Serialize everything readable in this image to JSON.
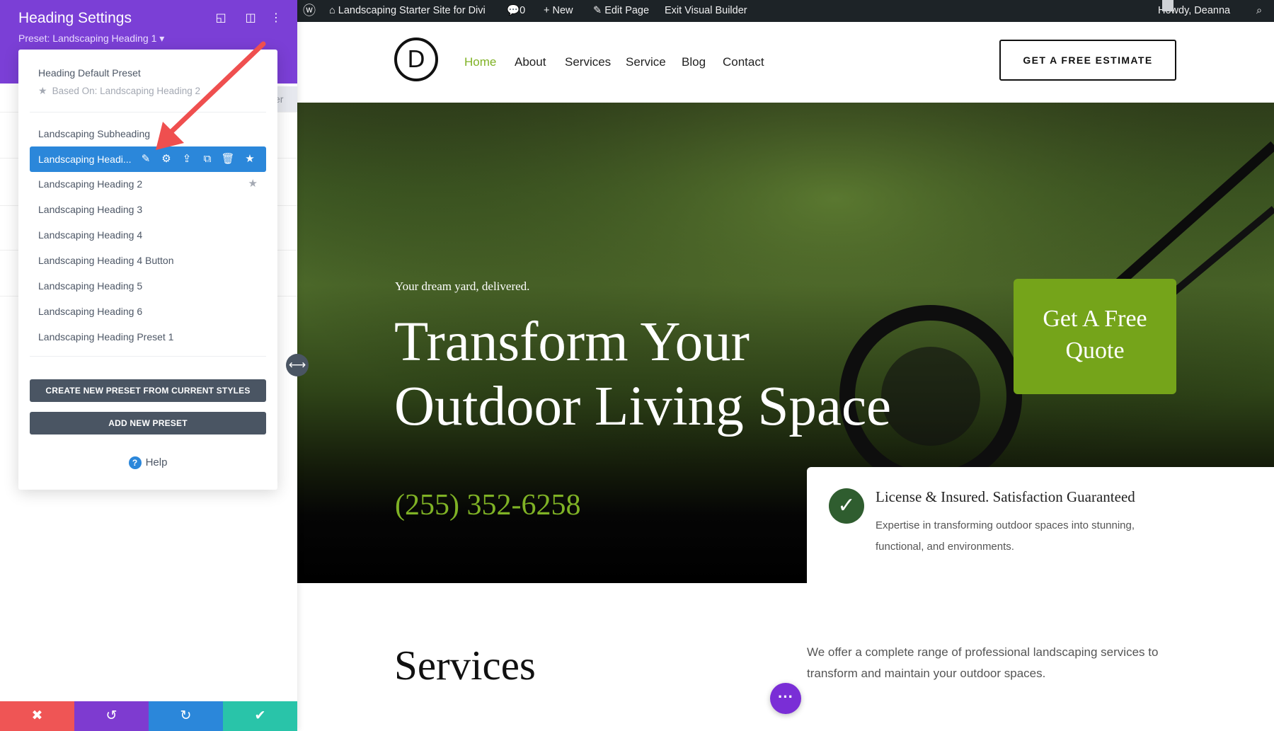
{
  "panel": {
    "title": "Heading Settings",
    "preset_label": "Preset: Landscaping Heading 1 ▾",
    "ghost_tab_text": "er"
  },
  "preset_dropdown": {
    "default_title": "Heading Default Preset",
    "based_on": "Based On: Landscaping Heading 2",
    "items": [
      {
        "label": "Landscaping Subheading"
      },
      {
        "label": "Landscaping Headi...",
        "active": true
      },
      {
        "label": "Landscaping Heading 2",
        "starred": true
      },
      {
        "label": "Landscaping Heading 3"
      },
      {
        "label": "Landscaping Heading 4"
      },
      {
        "label": "Landscaping Heading 4 Button"
      },
      {
        "label": "Landscaping Heading 5"
      },
      {
        "label": "Landscaping Heading 6"
      },
      {
        "label": "Landscaping Heading Preset 1"
      }
    ],
    "create_button": "CREATE NEW PRESET FROM CURRENT STYLES",
    "add_button": "ADD NEW PRESET",
    "help": "Help"
  },
  "adminbar": {
    "site_name": "Landscaping Starter Site for Divi",
    "comments": "0",
    "new": "New",
    "edit_page": "Edit Page",
    "exit": "Exit Visual Builder",
    "howdy": "Howdy, Deanna"
  },
  "nav": {
    "logo_letter": "D",
    "links": [
      "Home",
      "About",
      "Services",
      "Service",
      "Blog",
      "Contact"
    ],
    "active_color": "#7fb225",
    "cta": "GET A FREE ESTIMATE"
  },
  "hero": {
    "tagline": "Your dream yard, delivered.",
    "title_line1": "Transform Your",
    "title_line2": "Outdoor Living Space",
    "phone": "(255) 352-6258",
    "quote_line1": "Get A Free",
    "quote_line2": "Quote",
    "trust_title": "License & Insured. Satisfaction Guaranteed",
    "trust_text": "Expertise in transforming outdoor spaces into stunning, functional, and environments."
  },
  "services": {
    "title": "Services",
    "description": "We offer a complete range of professional landscaping services to transform and maintain your outdoor spaces."
  },
  "colors": {
    "panel_purple": "#7b3fd6",
    "active_blue": "#2b87da",
    "cancel_red": "#ef5555",
    "undo_purple": "#7e3bd0",
    "redo_blue": "#2b87da",
    "save_green": "#29c4a9",
    "brand_green": "#75a41a",
    "annotation_arrow": "#ef4f4f"
  }
}
